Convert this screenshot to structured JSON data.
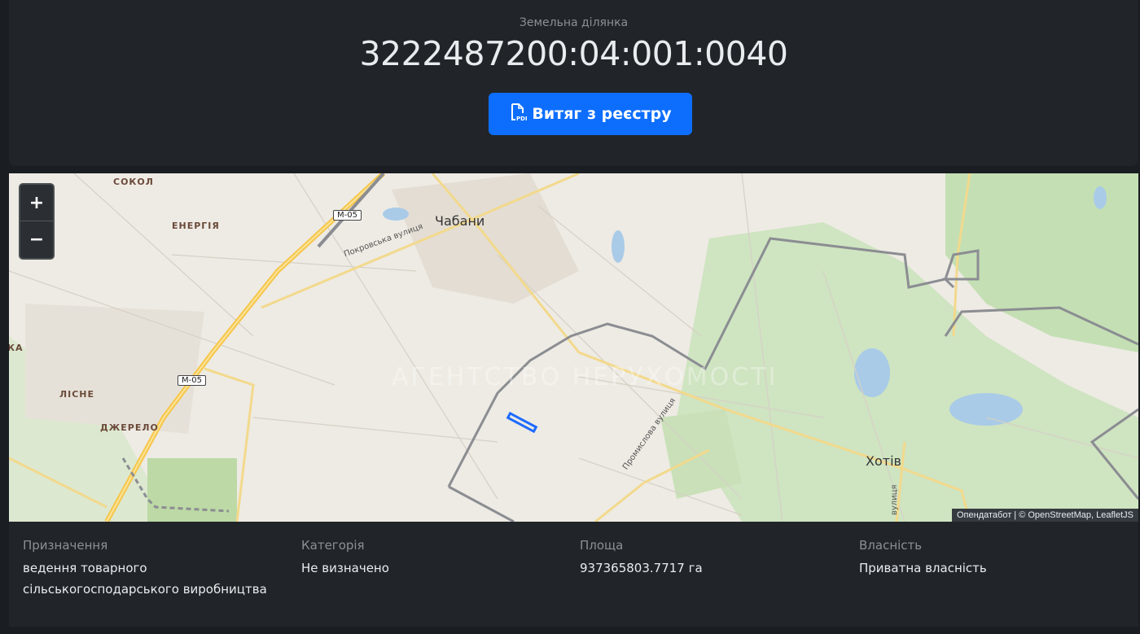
{
  "header": {
    "subtitle": "Земельна ділянка",
    "parcel_id": "3222487200:04:001:0040",
    "extract_button": "Витяг з реєстру",
    "extract_icon": "pdf-file-icon"
  },
  "map": {
    "zoom_in": "+",
    "zoom_out": "−",
    "attribution": "Опендатабот | © OpenStreetMap, LeafletJS",
    "labels": {
      "chabany": "Чабани",
      "khotiv": "Хотів",
      "sokol": "СОКОЛ",
      "energiya": "ЕНЕРГІЯ",
      "lisne": "ЛІСНЕ",
      "dzherelo": "ДЖЕРЕЛО",
      "edge_ka": "КА",
      "pokrovska": "Покровська вулиця",
      "promyslova": "Промислова вулиця",
      "vulytsia": "вулиця",
      "m05_a": "М-05",
      "m05_b": "М-05"
    },
    "watermark": "АГЕНТСТВО НЕРУХОМОСТІ",
    "colors": {
      "parcel": "#1e6bff",
      "boundary": "#8b8d92",
      "highway": "#f6c64a"
    }
  },
  "info": {
    "purpose": {
      "label": "Призначення",
      "value": "ведення товарного сільськогосподарського виробництва"
    },
    "category": {
      "label": "Категорія",
      "value": "Не визначено"
    },
    "area": {
      "label": "Площа",
      "value": "937365803.7717 га"
    },
    "ownership": {
      "label": "Власність",
      "value": "Приватна власність"
    }
  }
}
